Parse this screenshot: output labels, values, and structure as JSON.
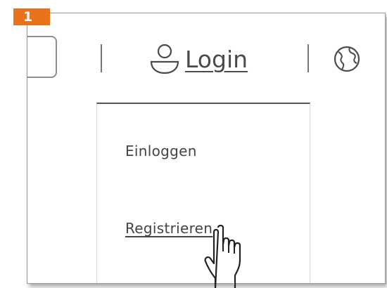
{
  "step": {
    "number": "1",
    "color": "#e8731c"
  },
  "header": {
    "login_label": "Login",
    "user_icon": "user-icon",
    "globe_icon": "globe-icon"
  },
  "dropdown": {
    "items": [
      {
        "label": "Einloggen",
        "underlined": false
      },
      {
        "label": "Registrieren",
        "underlined": true
      }
    ]
  },
  "cursor": {
    "icon": "hand-pointer-icon",
    "over": "Registrieren"
  }
}
